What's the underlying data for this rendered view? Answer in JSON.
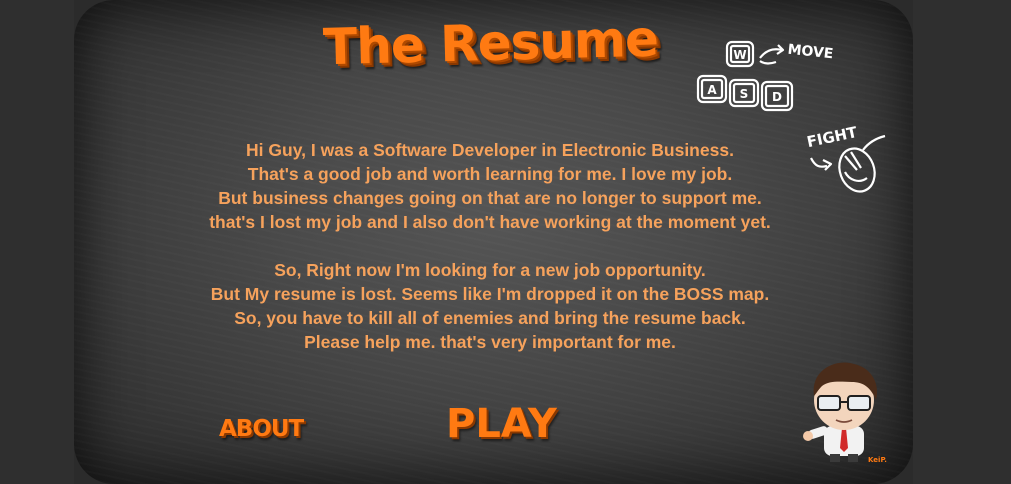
{
  "game": {
    "title": "The Resume"
  },
  "story": {
    "paragraph1": [
      "Hi Guy, I was a Software Developer in Electronic Business.",
      "That's a good job and worth learning for me. I love my job.",
      "But business changes going on that are no longer to support me.",
      "that's I lost my job and I also don't have working at the moment yet."
    ],
    "paragraph2": [
      "So, Right now I'm looking for a new job opportunity.",
      "But My resume is lost. Seems like I'm dropped it on the BOSS map.",
      "So, you have to kill all of enemies and bring the resume back.",
      "Please help me. that's very important for me."
    ]
  },
  "menu": {
    "about_label": "ABOUT",
    "play_label": "PLAY"
  },
  "controls_hint": {
    "move_label": "MOVE",
    "keys": [
      "W",
      "A",
      "S",
      "D"
    ],
    "fight_label": "FIGHT"
  },
  "character": {
    "signature": "KeiP."
  },
  "colors": {
    "accent": "#ff7a12",
    "story_text": "#f6a25c",
    "board": "#4a4a4a"
  }
}
